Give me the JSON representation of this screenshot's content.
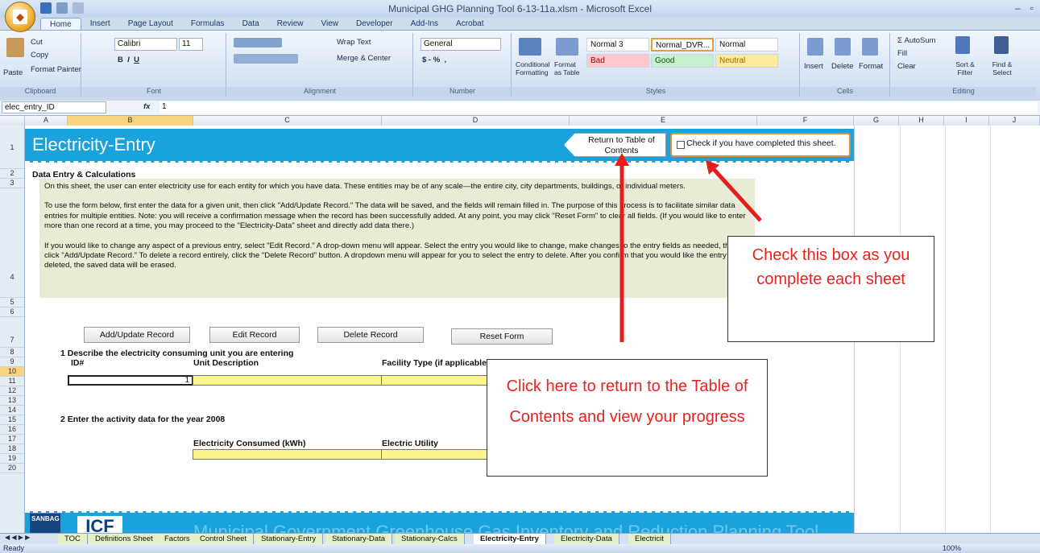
{
  "window": {
    "title": "Municipal GHG Planning Tool 6-13-11a.xlsm - Microsoft Excel"
  },
  "ribbon": {
    "tabs": [
      "Home",
      "Insert",
      "Page Layout",
      "Formulas",
      "Data",
      "Review",
      "View",
      "Developer",
      "Add-Ins",
      "Acrobat"
    ],
    "clipboard": {
      "paste": "Paste",
      "cut": "Cut",
      "copy": "Copy",
      "format_painter": "Format Painter",
      "label": "Clipboard"
    },
    "font": {
      "name": "Calibri",
      "size": "11",
      "label": "Font"
    },
    "alignment": {
      "wrap_text": "Wrap Text",
      "merge_center": "Merge & Center",
      "label": "Alignment"
    },
    "number": {
      "format": "General",
      "label": "Number"
    },
    "styles": {
      "conditional_formatting": "Conditional Formatting",
      "format_as_table": "Format as Table",
      "cells": [
        "Normal 3",
        "Normal_DVR...",
        "Normal",
        "Bad",
        "Good",
        "Neutral"
      ],
      "label": "Styles"
    },
    "cells": {
      "insert": "Insert",
      "delete": "Delete",
      "format": "Format",
      "label": "Cells"
    },
    "editing": {
      "autosum": "AutoSum",
      "fill": "Fill",
      "clear": "Clear",
      "sort_filter": "Sort & Filter",
      "find_select": "Find & Select",
      "label": "Editing"
    }
  },
  "formula_bar": {
    "name_box": "elec_entry_ID",
    "fx": "fx",
    "value": "1"
  },
  "columns": [
    "A",
    "B",
    "C",
    "D",
    "E",
    "F",
    "G",
    "H",
    "I",
    "J"
  ],
  "rows": [
    "1",
    "2",
    "3",
    "4",
    "5",
    "6",
    "7",
    "8",
    "9",
    "10",
    "11",
    "12",
    "13",
    "14",
    "15",
    "16",
    "17",
    "18",
    "19",
    "20"
  ],
  "sheet": {
    "title": "Electricity-Entry",
    "toc_button": "Return to Table of Contents",
    "complete_check": "Check if you have completed this sheet.",
    "section_header": "Data Entry & Calculations",
    "instructions": [
      "On this sheet, the user can enter electricity use for each entity for which you have data. These entities may be of any scale—the entire city, city departments, buildings, or individual meters.",
      "To use the form below, first enter the data for a given unit, then click \"Add/Update Record.\" The data will be saved, and the fields will remain filled in. The purpose of this process is to facilitate similar data entries for multiple entities. Note: you will receive a confirmation message when the record has been successfully added. At any point, you may click \"Reset Form\" to clear all fields. (If you would like to enter more than one record at a time, you may proceed to the \"Electricity-Data\" sheet and directly add data there.)",
      "If you would like to change any aspect of a previous entry, select \"Edit Record.\" A drop-down menu will appear. Select the entry you would like to change, make changes to the entry fields as needed, then click \"Add/Update Record.\" To delete a record entirely, click the \"Delete Record\" button. A dropdown menu will appear for you to select the entry to delete. After you confirm that you would like the entry deleted, the saved data will be erased."
    ],
    "buttons": {
      "add_update": "Add/Update Record",
      "edit": "Edit Record",
      "delete": "Delete Record",
      "reset": "Reset Form"
    },
    "step1": "1 Describe the electricity consuming unit you are entering",
    "col_id": "ID#",
    "col_unit": "Unit Description",
    "col_facility": "Facility Type (if applicable",
    "id_value": "1",
    "step2": "2 Enter the activity data for the year 2008",
    "col_elec": "Electricity Consumed (kWh)",
    "col_utility": "Electric Utility",
    "footer_logo1": "SANBAG",
    "footer_logo2": "ICF",
    "footer_title": "Municipal Government Greenhouse Gas Inventory and Reduction Planning Tool"
  },
  "sheet_tabs": [
    "TOC",
    "Definitions Sheet",
    "Factors",
    "Control Sheet",
    "Stationary-Entry",
    "Stationary-Data",
    "Stationary-Calcs",
    "Electricity-Entry",
    "Electricity-Data",
    "Electricit"
  ],
  "status": {
    "ready": "Ready",
    "zoom": "100%"
  },
  "callouts": {
    "check": "Check this box as you complete each sheet",
    "toc": "Click here to return to the Table of Contents and view your progress"
  },
  "colors": {
    "banner": "#1aa2dc",
    "callout_text": "#e8231e",
    "yellow_cell": "#fbf58c",
    "instructions_bg": "#e8ecd4"
  }
}
